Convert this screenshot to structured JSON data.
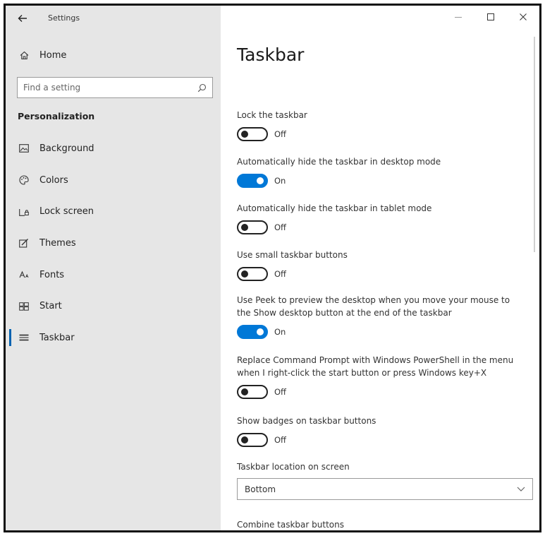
{
  "window": {
    "app_title": "Settings"
  },
  "sidebar": {
    "home_label": "Home",
    "search_placeholder": "Find a setting",
    "section_header": "Personalization",
    "items": [
      {
        "label": "Background",
        "icon": "image-icon"
      },
      {
        "label": "Colors",
        "icon": "palette-icon"
      },
      {
        "label": "Lock screen",
        "icon": "lock-screen-icon"
      },
      {
        "label": "Themes",
        "icon": "themes-icon"
      },
      {
        "label": "Fonts",
        "icon": "fonts-icon"
      },
      {
        "label": "Start",
        "icon": "start-icon"
      },
      {
        "label": "Taskbar",
        "icon": "taskbar-icon",
        "active": true
      }
    ]
  },
  "content": {
    "page_title": "Taskbar",
    "settings": [
      {
        "label": "Lock the taskbar",
        "state": "Off"
      },
      {
        "label": "Automatically hide the taskbar in desktop mode",
        "state": "On"
      },
      {
        "label": "Automatically hide the taskbar in tablet mode",
        "state": "Off"
      },
      {
        "label": "Use small taskbar buttons",
        "state": "Off"
      },
      {
        "label": "Use Peek to preview the desktop when you move your mouse to the Show desktop button at the end of the taskbar",
        "state": "On"
      },
      {
        "label": "Replace Command Prompt with Windows PowerShell in the menu when I right-click the start button or press Windows key+X",
        "state": "Off"
      },
      {
        "label": "Show badges on taskbar buttons",
        "state": "Off"
      }
    ],
    "location_label": "Taskbar location on screen",
    "location_value": "Bottom",
    "combine_label": "Combine taskbar buttons"
  },
  "colors": {
    "accent": "#0078d7",
    "sidebar_bg": "#e6e6e6",
    "content_bg": "#ffffff"
  }
}
